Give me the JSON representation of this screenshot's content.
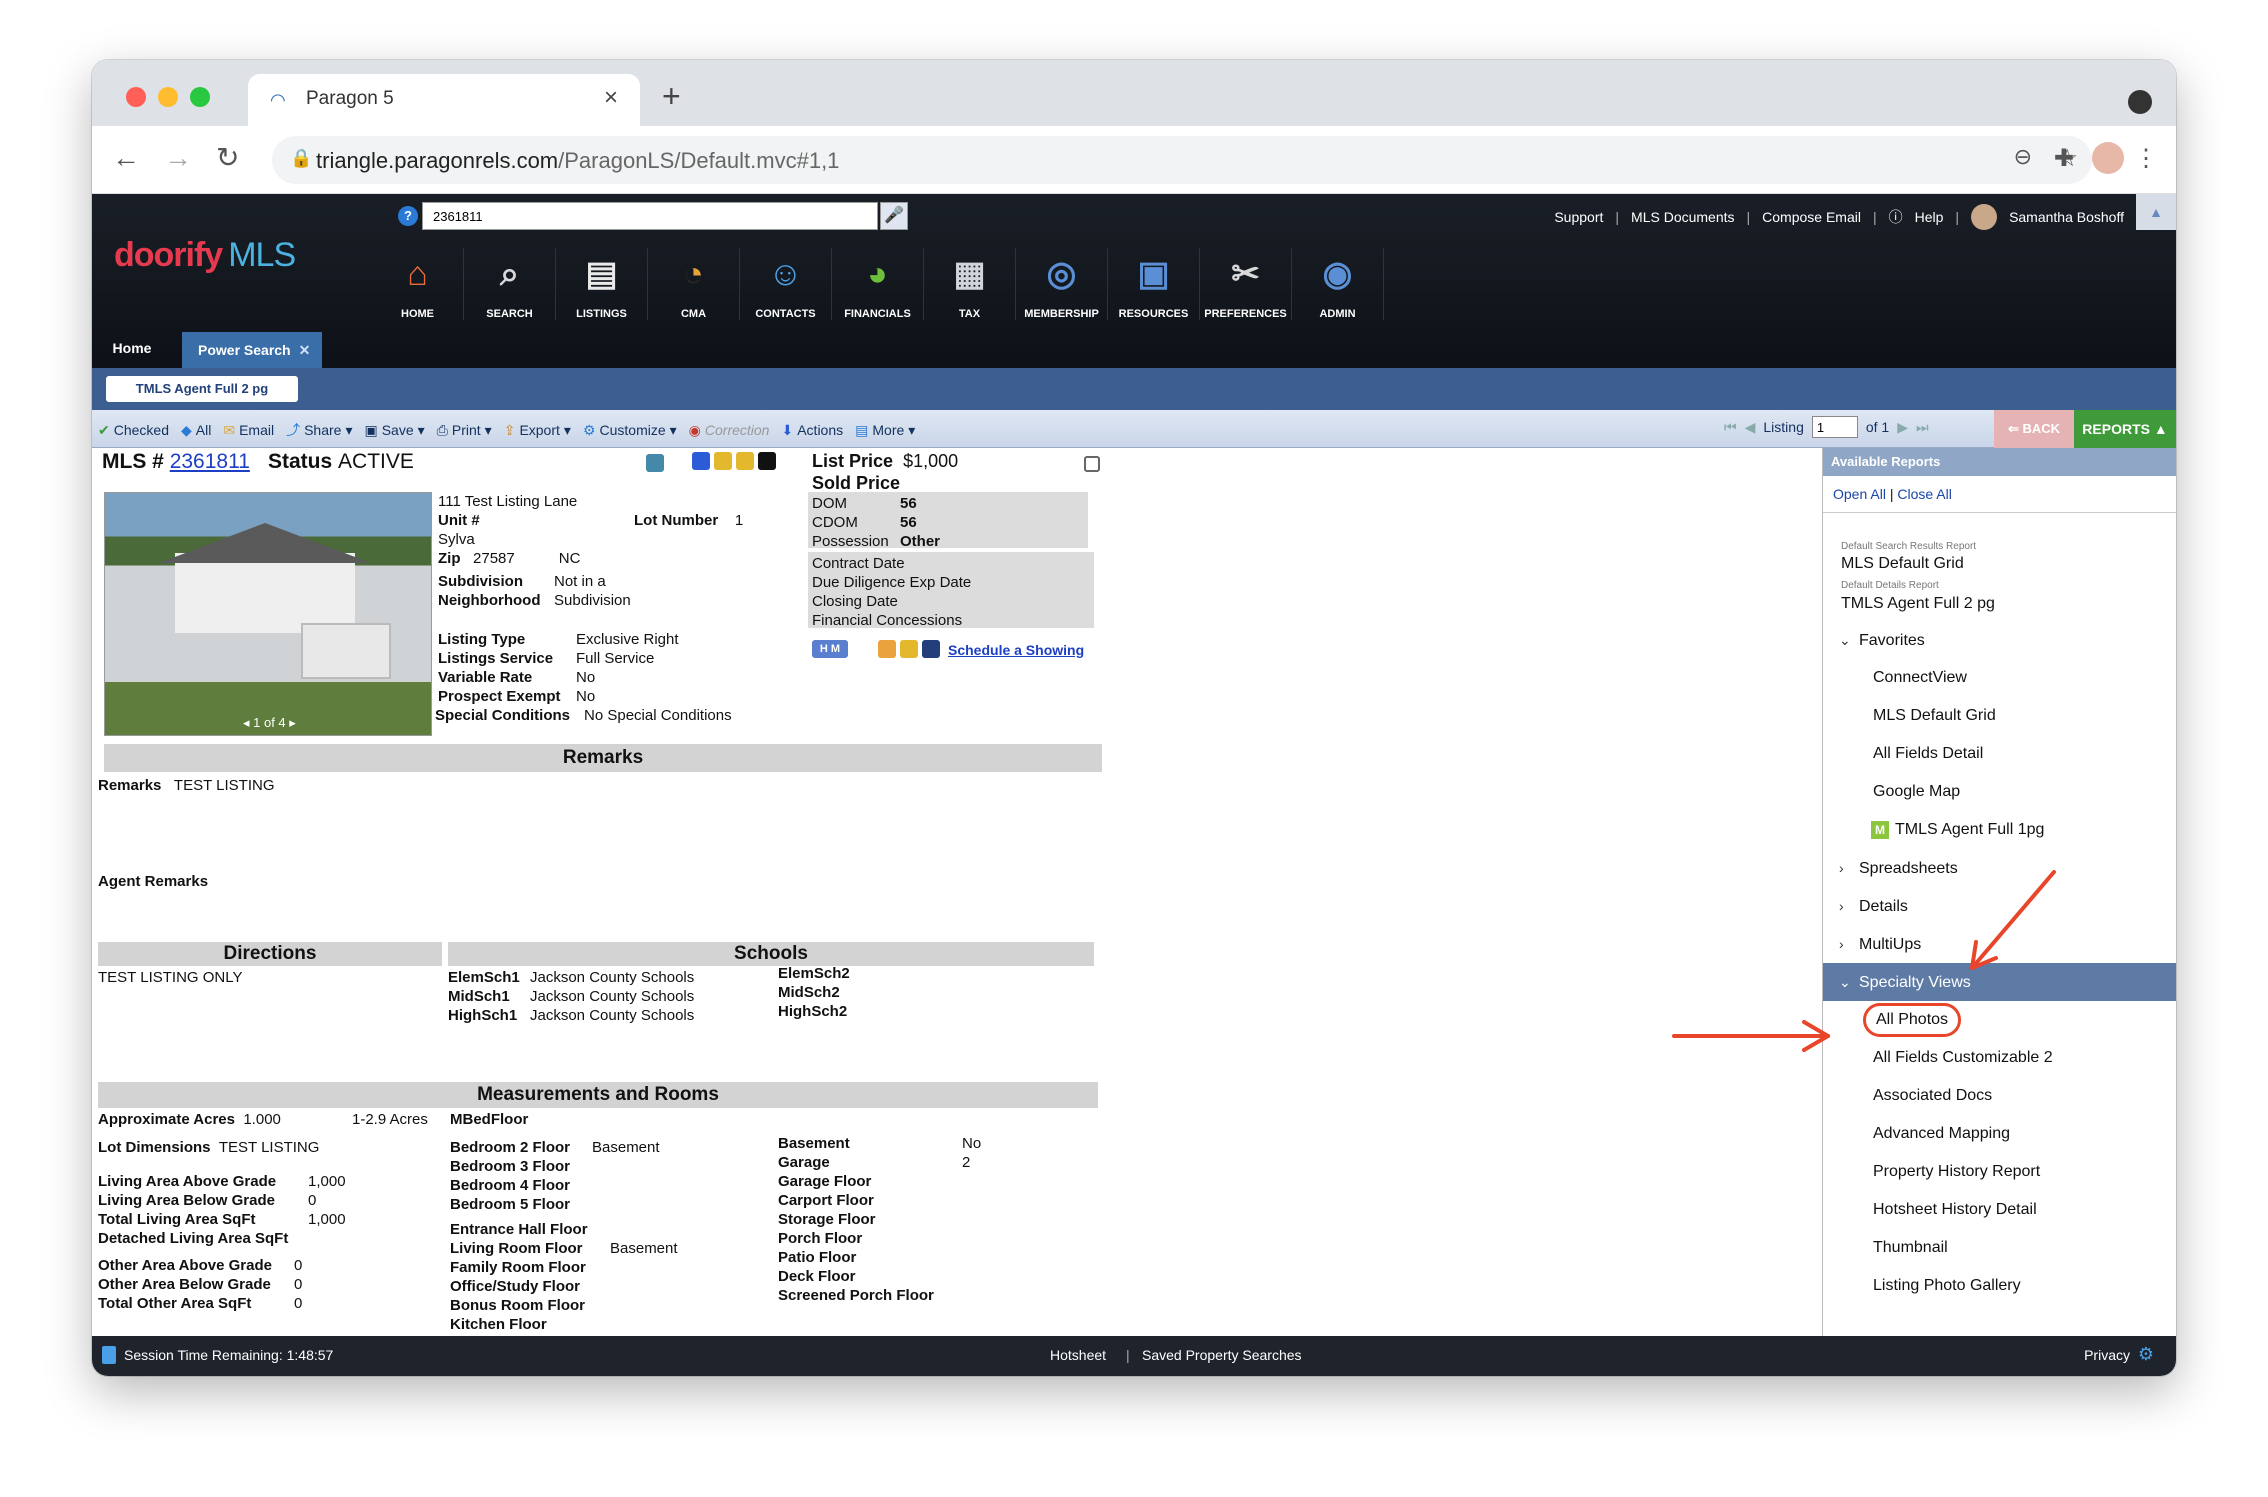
{
  "browser": {
    "tab_title": "Paragon 5",
    "url_host": "triangle.paragonrels.com",
    "url_path": "/ParagonLS/Default.mvc#1,1"
  },
  "header": {
    "logo_main": "doorify",
    "logo_mls": "MLS",
    "quick_search_value": "2361811",
    "links": {
      "support": "Support",
      "mls_docs": "MLS Documents",
      "compose": "Compose Email",
      "help": "Help",
      "user": "Samantha Boshoff"
    },
    "nav": [
      "HOME",
      "SEARCH",
      "LISTINGS",
      "CMA",
      "CONTACTS",
      "FINANCIALS",
      "TAX",
      "MEMBERSHIP",
      "RESOURCES",
      "PREFERENCES",
      "ADMIN"
    ],
    "nav_icons": [
      "house-icon",
      "search-icon",
      "listings-icon",
      "cma-icon",
      "contacts-icon",
      "financials-icon",
      "tax-icon",
      "membership-icon",
      "resources-icon",
      "preferences-icon",
      "admin-icon"
    ],
    "tab_home": "Home",
    "tab_power": "Power Search",
    "subtab": "TMLS Agent Full 2 pg"
  },
  "toolbar": {
    "checked": "Checked",
    "all": "All",
    "email": "Email",
    "share": "Share",
    "save": "Save",
    "print": "Print",
    "export": "Export",
    "customize": "Customize",
    "correction": "Correction",
    "actions": "Actions",
    "more": "More",
    "listing_label": "Listing",
    "listing_value": "1",
    "of_total": "of 1",
    "back": "BACK",
    "reports": "REPORTS"
  },
  "listing": {
    "mls_label": "MLS #",
    "mls_number": "2361811",
    "status_label": "Status",
    "status_value": "ACTIVE",
    "photo_counter": "1 of 4",
    "address": "111 Test Listing Lane",
    "unit_label": "Unit #",
    "lot_label": "Lot Number",
    "lot_value": "1",
    "city": "Sylva",
    "zip_label": "Zip",
    "zip_value": "27587",
    "state": "NC",
    "subdivision_label": "Subdivision",
    "subdivision_value": "Not in a Subdivision",
    "neighborhood_label": "Neighborhood",
    "listing_type_label": "Listing Type",
    "listing_type_value": "Exclusive Right",
    "listings_service_label": "Listings Service",
    "listings_service_value": "Full Service",
    "variable_rate_label": "Variable Rate",
    "variable_rate_value": "No",
    "prospect_exempt_label": "Prospect Exempt",
    "prospect_exempt_value": "No",
    "special_label": "Special Conditions",
    "special_value": "No Special Conditions",
    "list_price_label": "List Price",
    "list_price_value": "$1,000",
    "sold_price_label": "Sold Price",
    "dom_label": "DOM",
    "dom_value": "56",
    "cdom_label": "CDOM",
    "cdom_value": "56",
    "possession_label": "Possession",
    "possession_value": "Other",
    "contract_date": "Contract Date",
    "due_diligence": "Due Diligence Exp Date",
    "closing_date": "Closing Date",
    "financial_concessions": "Financial Concessions",
    "schedule": "Schedule a Showing",
    "remarks_title": "Remarks",
    "remarks_label": "Remarks",
    "remarks_value": "TEST LISTING",
    "agent_remarks_label": "Agent Remarks",
    "directions_title": "Directions",
    "directions_value": "TEST LISTING ONLY",
    "schools_title": "Schools",
    "elem1_label": "ElemSch1",
    "elem1_value": "Jackson County Schools",
    "mid1_label": "MidSch1",
    "mid1_value": "Jackson County Schools",
    "high1_label": "HighSch1",
    "high1_value": "Jackson County Schools",
    "elem2_label": "ElemSch2",
    "mid2_label": "MidSch2",
    "high2_label": "HighSch2",
    "meas_title": "Measurements and Rooms",
    "approx_acres_label": "Approximate Acres",
    "approx_acres_value": "1.000",
    "acres_range": "1-2.9 Acres",
    "mbed_label": "MBedFloor",
    "lot_dim_label": "Lot Dimensions",
    "lot_dim_value": "TEST LISTING",
    "living_above_label": "Living Area Above Grade",
    "living_above_value": "1,000",
    "living_below_label": "Living Area Below Grade",
    "living_below_value": "0",
    "total_living_label": "Total Living Area SqFt",
    "total_living_value": "1,000",
    "detached_label": "Detached Living Area SqFt",
    "other_above_label": "Other Area Above Grade",
    "other_above_value": "0",
    "other_below_label": "Other Area Below Grade",
    "other_below_value": "0",
    "total_other_label": "Total Other Area SqFt",
    "total_other_value": "0",
    "bed2_label": "Bedroom 2 Floor",
    "bed2_value": "Basement",
    "bed3_label": "Bedroom 3 Floor",
    "bed4_label": "Bedroom 4 Floor",
    "bed5_label": "Bedroom 5 Floor",
    "entrance_label": "Entrance Hall Floor",
    "living_room_label": "Living Room Floor",
    "living_room_value": "Basement",
    "family_label": "Family Room Floor",
    "office_label": "Office/Study Floor",
    "bonus_label": "Bonus Room Floor",
    "kitchen_label": "Kitchen Floor",
    "basement_label": "Basement",
    "basement_value": "No",
    "garage_label": "Garage",
    "garage_value": "2",
    "garage_floor_label": "Garage Floor",
    "carport_label": "Carport Floor",
    "storage_label": "Storage Floor",
    "porch_label": "Porch Floor",
    "patio_label": "Patio Floor",
    "deck_label": "Deck Floor",
    "screened_label": "Screened Porch Floor"
  },
  "reports_panel": {
    "title": "Available Reports",
    "open_all": "Open All",
    "close_all": "Close All",
    "default_search_caption": "Default Search Results Report",
    "default_search": "MLS Default Grid",
    "default_details_caption": "Default Details Report",
    "default_details": "TMLS Agent Full 2 pg",
    "favorites": "Favorites",
    "favorites_items": [
      "ConnectView",
      "MLS Default Grid",
      "All Fields Detail",
      "Google Map",
      "TMLS Agent Full 1pg"
    ],
    "spreadsheets": "Spreadsheets",
    "details": "Details",
    "multiups": "MultiUps",
    "specialty": "Specialty Views",
    "specialty_items": [
      "All Photos",
      "All Fields Customizable 2",
      "Associated Docs",
      "Advanced Mapping",
      "Property History Report",
      "Hotsheet History Detail",
      "Thumbnail",
      "Listing Photo Gallery"
    ]
  },
  "footer": {
    "session": "Session Time Remaining: 1:48:57",
    "hotsheet": "Hotsheet",
    "saved": "Saved Property Searches",
    "privacy": "Privacy"
  },
  "colors": {
    "annotation": "#e8452a",
    "reports_green": "#3f9b3a",
    "specialty_selected": "#5e7ba5"
  }
}
